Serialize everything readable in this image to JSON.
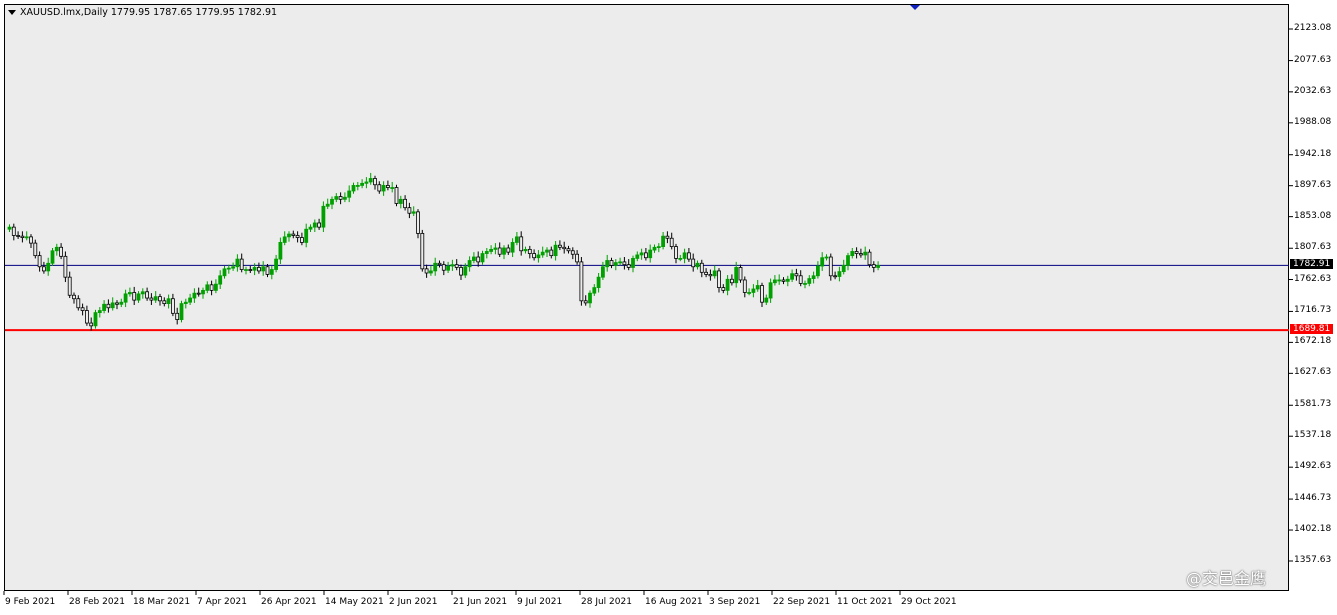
{
  "header": {
    "symbol_line": "XAUUSD.lmx,Daily  1779.95 1787.65 1779.95 1782.91"
  },
  "colors": {
    "background": "#ececec",
    "bull": "#00a000",
    "bear": "#000000",
    "current_line": "#000080",
    "level_line": "#ff0000",
    "marker": "#1020c0"
  },
  "price_axis": {
    "ticks": [
      "2123.08",
      "2077.63",
      "2032.63",
      "1988.08",
      "1942.18",
      "1897.63",
      "1853.08",
      "1807.63",
      "1762.63",
      "1716.73",
      "1672.18",
      "1627.63",
      "1581.73",
      "1537.18",
      "1492.63",
      "1446.73",
      "1402.18",
      "1357.63"
    ],
    "current_price": "1782.91",
    "level_price": "1689.81"
  },
  "time_axis": {
    "ticks": [
      "9 Feb 2021",
      "28 Feb 2021",
      "18 Mar 2021",
      "7 Apr 2021",
      "26 Apr 2021",
      "14 May 2021",
      "2 Jun 2021",
      "21 Jun 2021",
      "9 Jul 2021",
      "28 Jul 2021",
      "16 Aug 2021",
      "3 Sep 2021",
      "22 Sep 2021",
      "11 Oct 2021",
      "29 Oct 2021"
    ]
  },
  "watermark": "@交邑金鹰",
  "chart_data": {
    "type": "candlestick",
    "symbol": "XAUUSD.lmx",
    "timeframe": "Daily",
    "last_ohlc": {
      "open": 1779.95,
      "high": 1787.65,
      "low": 1779.95,
      "close": 1782.91
    },
    "ylim": [
      1357.63,
      2123.08
    ],
    "horizontal_lines": [
      {
        "price": 1782.91,
        "color": "#000080"
      },
      {
        "price": 1689.81,
        "color": "#ff0000"
      }
    ],
    "series": [
      {
        "name": "XAUUSD.lmx",
        "close": [
          1838,
          1826,
          1825,
          1823,
          1824,
          1815,
          1797,
          1781,
          1775,
          1786,
          1804,
          1809,
          1796,
          1766,
          1740,
          1735,
          1722,
          1718,
          1700,
          1696,
          1715,
          1718,
          1727,
          1722,
          1729,
          1727,
          1730,
          1742,
          1744,
          1733,
          1742,
          1745,
          1736,
          1733,
          1738,
          1732,
          1728,
          1735,
          1714,
          1705,
          1728,
          1730,
          1736,
          1743,
          1742,
          1747,
          1755,
          1747,
          1756,
          1768,
          1778,
          1779,
          1781,
          1792,
          1777,
          1777,
          1776,
          1780,
          1775,
          1781,
          1770,
          1777,
          1792,
          1816,
          1824,
          1828,
          1826,
          1823,
          1816,
          1835,
          1838,
          1844,
          1838,
          1868,
          1871,
          1878,
          1882,
          1878,
          1881,
          1890,
          1898,
          1898,
          1901,
          1903,
          1908,
          1899,
          1890,
          1898,
          1895,
          1895,
          1872,
          1878,
          1866,
          1858,
          1860,
          1829,
          1778,
          1772,
          1775,
          1786,
          1784,
          1776,
          1782,
          1784,
          1780,
          1769,
          1781,
          1790,
          1795,
          1788,
          1800,
          1803,
          1806,
          1808,
          1799,
          1808,
          1802,
          1816,
          1824,
          1804,
          1806,
          1800,
          1794,
          1798,
          1802,
          1805,
          1797,
          1812,
          1809,
          1807,
          1804,
          1799,
          1788,
          1732,
          1729,
          1743,
          1751,
          1766,
          1781,
          1790,
          1783,
          1787,
          1788,
          1784,
          1780,
          1793,
          1798,
          1801,
          1794,
          1805,
          1809,
          1810,
          1825,
          1822,
          1810,
          1793,
          1793,
          1801,
          1792,
          1781,
          1786,
          1773,
          1770,
          1768,
          1775,
          1751,
          1747,
          1763,
          1758,
          1780,
          1762,
          1744,
          1744,
          1749,
          1754,
          1730,
          1736,
          1758,
          1762,
          1762,
          1760,
          1763,
          1771,
          1768,
          1757,
          1757,
          1764,
          1768,
          1782,
          1794,
          1795,
          1768,
          1767,
          1774,
          1783,
          1797,
          1803,
          1800,
          1798,
          1802,
          1784,
          1780,
          1782.91
        ]
      }
    ]
  }
}
